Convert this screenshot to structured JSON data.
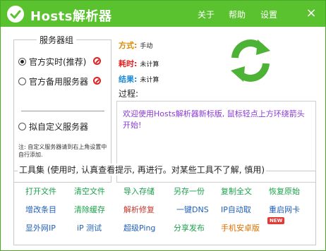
{
  "title": "Hosts解析器",
  "menu": [
    "关于",
    "帮助",
    "设置"
  ],
  "close_label": "×",
  "server_group": {
    "legend": "服务器组",
    "options": [
      {
        "label": "官方实时(推荐)",
        "checked": true,
        "blocked": true
      },
      {
        "label": "官方备用服务器",
        "checked": false,
        "blocked": true
      },
      {
        "label": "拟自定义服务器",
        "checked": false,
        "blocked": false
      }
    ],
    "note": "注: 自定义服务器请到右上角设置中自行添加."
  },
  "status": {
    "mode_key": "方式:",
    "mode_value": "手动",
    "time_key": "耗时:",
    "time_value": "未计算",
    "result_key": "结果:",
    "result_value": "未计算"
  },
  "process": {
    "label": "过程:",
    "text": "欢迎使用Hosts解析器新标版, 鼠标轻点上方环绕箭头开始!"
  },
  "toolset": {
    "legend": "工具集 (使用时, 认真查看提示, 再进行。对某些工具不了解, 慎用)",
    "tools": [
      "打开文件",
      "清空文件",
      "导入存储",
      "另存一份",
      "复制全文",
      "恢复原始",
      "增改条目",
      "清除缓存",
      "解析修复",
      "一键DNS",
      "IP自动取",
      "重启网卡",
      "显外网IP",
      "iP 测试",
      "超级Ping",
      "分享发布",
      "手机安卓版"
    ],
    "new_badge": "NEW"
  },
  "colors": {
    "titlebar": "#5ac12f",
    "accent_green": "#1aa14a",
    "accent_blue": "#1f5fb8",
    "accent_red": "#c0392b",
    "accent_orange": "#e07000",
    "process_text": "#8a3bd6"
  },
  "icons": {
    "logo": "check-circle-icon",
    "refresh": "refresh-arrows-icon",
    "blocked": "no-entry-icon"
  }
}
